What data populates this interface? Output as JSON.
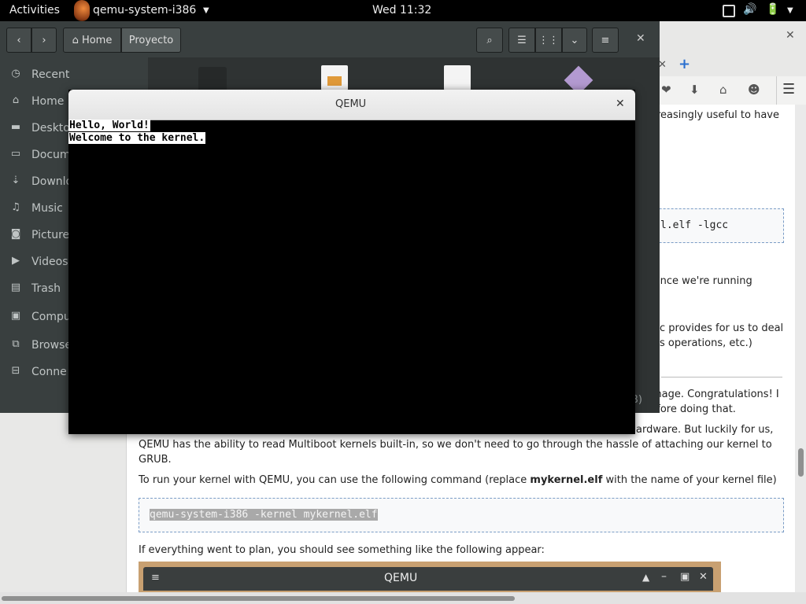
{
  "topbar": {
    "activities": "Activities",
    "app_menu": "qemu-system-i386",
    "clock": "Wed 11:32"
  },
  "files": {
    "path": [
      "Home",
      "Proyecto"
    ],
    "sidebar": [
      {
        "label": "Recent",
        "icon": "clock-icon"
      },
      {
        "label": "Home",
        "icon": "home-icon"
      },
      {
        "label": "Deskto",
        "icon": "folder-icon"
      },
      {
        "label": "Docum",
        "icon": "document-icon"
      },
      {
        "label": "Downlo",
        "icon": "download-icon"
      },
      {
        "label": "Music",
        "icon": "music-icon"
      },
      {
        "label": "Picture",
        "icon": "camera-icon"
      },
      {
        "label": "Videos",
        "icon": "video-icon"
      },
      {
        "label": "Trash",
        "icon": "trash-icon"
      },
      {
        "label": "Compu",
        "icon": "computer-icon"
      },
      {
        "label": "Browse",
        "icon": "network-icon"
      },
      {
        "label": "Conne",
        "icon": "connect-icon"
      }
    ],
    "status_fragment": "B)"
  },
  "qemu": {
    "title": "QEMU",
    "lines": [
      "Hello, World!",
      "Welcome to the kernel."
    ]
  },
  "browser": {
    "frag_1": "reasingly useful to have",
    "code_1": "l.elf -lgcc",
    "frag_2": ", since we're running",
    "frag_3": "c provides for us to deal",
    "frag_4": "s operations, etc.)",
    "frag_5": "mage. Congratulations! I",
    "frag_6": "before doing that.",
    "frag_7": "ardware. But luckily for us,",
    "p1_line2": "QEMU has the ability to read Multiboot kernels built-in, so we don't need to go through the hassle of attaching our kernel to",
    "p1_line3": "GRUB.",
    "p2_pre": "To run your kernel with QEMU, you can use the following command (replace ",
    "p2_bold": "mykernel.elf",
    "p2_post": " with the name of your kernel file)",
    "code_2": "qemu-system-i386 -kernel mykernel.elf",
    "p3": "If everything went to plan, you should see something like the following appear:",
    "embedded_title": "QEMU"
  }
}
